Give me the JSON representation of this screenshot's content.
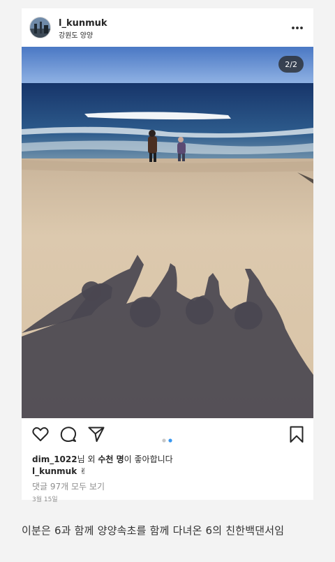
{
  "post": {
    "username": "l_kunmuk",
    "location": "강원도 양양",
    "image_counter": "2/2",
    "likes": {
      "user": "dim_1022",
      "mid": "님 외 ",
      "count": "수천 명",
      "suffix": "이 좋아합니다"
    },
    "caption_user": "l_kunmuk",
    "caption_emoji": "✌",
    "comments_link": "댓글 97개 모두 보기",
    "date": "3월 15일"
  },
  "carousel": {
    "total": 2,
    "active": 2
  },
  "footer_text": "이분은 6과 함께 양양속초를 함께 다녀온 6의 친한백댄서임",
  "colors": {
    "accent_dot": "#3897f0",
    "inactive_dot": "#c7c7c7",
    "text": "#262626",
    "muted": "#8e8e8e"
  },
  "icons": [
    "more-options-icon",
    "heart-icon",
    "comment-icon",
    "share-icon",
    "bookmark-icon"
  ]
}
